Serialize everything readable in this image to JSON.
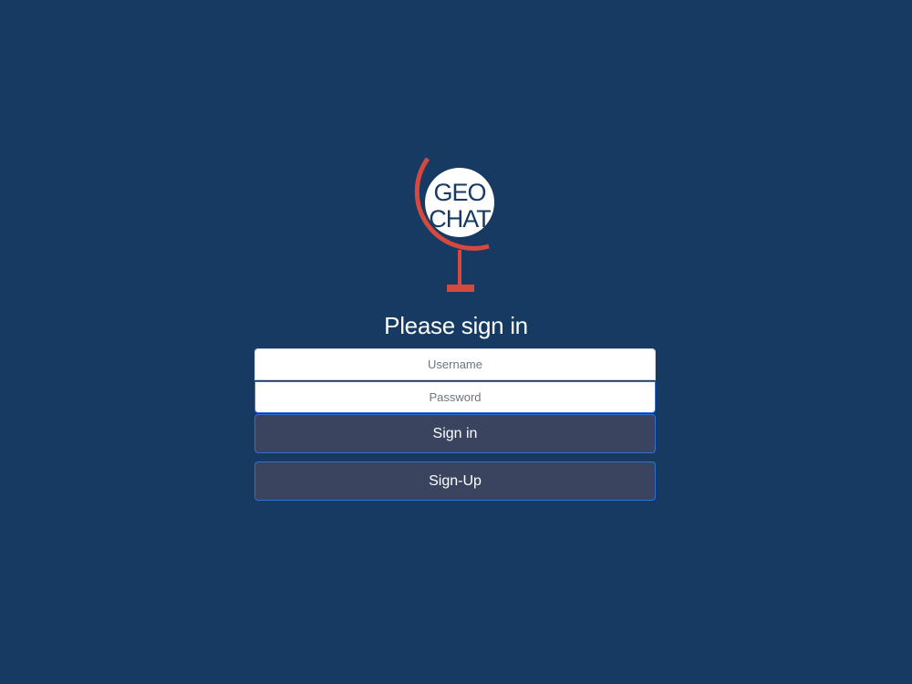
{
  "logo": {
    "line1": "GEO",
    "line2": "CHAT",
    "icon": "globe-icon",
    "colors": {
      "globe_stand": "#d44a3f",
      "globe_face": "#ffffff",
      "text": "#163a62"
    }
  },
  "heading": "Please sign in",
  "form": {
    "username_placeholder": "Username",
    "password_placeholder": "Password",
    "signin_label": "Sign in",
    "signup_label": "Sign-Up"
  },
  "colors": {
    "background": "#163a62",
    "button_bg": "#3a445e",
    "button_border": "#2f6fd6"
  }
}
